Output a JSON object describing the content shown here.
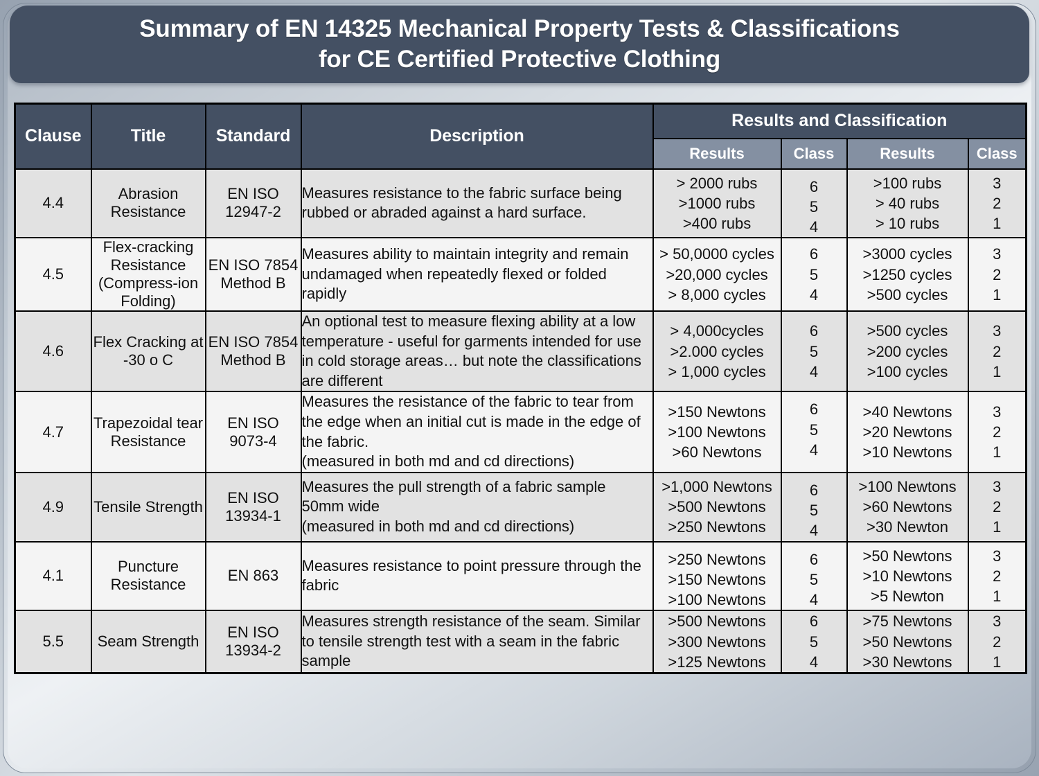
{
  "title": {
    "line1": "Summary of EN 14325 Mechanical Property Tests & Classifications",
    "line2": "for CE Certified Protective Clothing"
  },
  "colors": {
    "header_dark": "#445063",
    "header_light": "#8490a2",
    "row_shade": "#e2e2e2",
    "row_plain": "#f4f4f4",
    "border": "#000000",
    "title_text": "#ffffff"
  },
  "table": {
    "headers": {
      "clause": "Clause",
      "title": "Title",
      "standard": "Standard",
      "description": "Description",
      "group": "Results and Classification",
      "results_a": "Results",
      "class_a": "Class",
      "results_b": "Results",
      "class_b": "Class"
    },
    "rows": [
      {
        "clause": "4.4",
        "title": "Abrasion Resistance",
        "standard": "EN ISO 12947-2",
        "description": "Measures resistance to the fabric surface being rubbed or abraded against a hard surface.",
        "results_a": [
          "> 2000 rubs",
          ">1000 rubs",
          ">400 rubs"
        ],
        "class_a": [
          "6",
          "5",
          "4"
        ],
        "results_b": [
          ">100 rubs",
          "> 40 rubs",
          "> 10 rubs"
        ],
        "class_b": [
          "3",
          "2",
          "1"
        ],
        "shade": "shade",
        "class_a_align": "top",
        "class_b_align": "middle",
        "results_a_align": "middle",
        "results_b_align": "middle"
      },
      {
        "clause": "4.5",
        "title": "Flex-cracking Resistance (Compress-ion Folding)",
        "standard": "EN ISO 7854 Method B",
        "description": "Measures ability to maintain integrity and remain undamaged when repeatedly flexed or folded rapidly",
        "results_a": [
          "> 50,0000 cycles",
          ">20,000 cycles",
          "> 8,000 cycles"
        ],
        "class_a": [
          "6",
          "5",
          "4"
        ],
        "results_b": [
          ">3000 cycles",
          ">1250 cycles",
          ">500 cycles"
        ],
        "class_b": [
          "3",
          "2",
          "1"
        ],
        "shade": "plain",
        "class_a_align": "middle",
        "class_b_align": "middle",
        "results_a_align": "middle",
        "results_b_align": "middle"
      },
      {
        "clause": "4.6",
        "title": "Flex Cracking at -30 o C",
        "standard": "EN ISO 7854 Method B",
        "description": "An optional test to measure flexing ability at a low temperature - useful for garments intended for use in cold storage areas… but note the classifications are different",
        "results_a": [
          "> 4,000cycles",
          ">2.000 cycles",
          "> 1,000 cycles"
        ],
        "class_a": [
          "6",
          "5",
          "4"
        ],
        "results_b": [
          ">500 cycles",
          ">200 cycles",
          ">100 cycles"
        ],
        "class_b": [
          "3",
          "2",
          "1"
        ],
        "shade": "shade",
        "class_a_align": "middle",
        "class_b_align": "middle",
        "results_a_align": "middle",
        "results_b_align": "middle"
      },
      {
        "clause": "4.7",
        "title": "Trapezoidal tear Resistance",
        "standard": "EN ISO 9073-4",
        "description": "Measures the resistance of the fabric to tear from the edge when an initial cut is made in the edge of the fabric.\n(measured in both md and cd directions)",
        "results_a": [
          ">150 Newtons",
          ">100 Newtons",
          ">60 Newtons"
        ],
        "class_a": [
          "6",
          "5",
          "4"
        ],
        "results_b": [
          ">40 Newtons",
          ">20 Newtons",
          ">10 Newtons"
        ],
        "class_b": [
          "3",
          "2",
          "1"
        ],
        "shade": "plain",
        "class_a_align": "top",
        "class_b_align": "middle",
        "results_a_align": "middle",
        "results_b_align": "middle"
      },
      {
        "clause": "4.9",
        "title": "Tensile Strength",
        "standard": "EN ISO 13934-1",
        "description": "Measures the pull strength of a fabric sample 50mm wide\n(measured in both md and cd directions)",
        "results_a": [
          ">1,000 Newtons",
          ">500 Newtons",
          ">250 Newtons"
        ],
        "class_a": [
          "6",
          "5",
          "4"
        ],
        "results_b": [
          ">100 Newtons",
          ">60 Newtons",
          ">30 Newton"
        ],
        "class_b": [
          "3",
          "2",
          "1"
        ],
        "shade": "shade",
        "class_a_align": "top",
        "class_b_align": "middle",
        "results_a_align": "middle",
        "results_b_align": "middle"
      },
      {
        "clause": "4.1",
        "title": "Puncture Resistance",
        "standard": "EN 863",
        "description": "Measures resistance to point pressure through the fabric",
        "results_a": [
          ">250 Newtons",
          ">150 Newtons",
          ">100 Newtons"
        ],
        "class_a": [
          "6",
          "5",
          "4"
        ],
        "results_b": [
          ">50 Newtons",
          ">10 Newtons",
          ">5 Newton"
        ],
        "class_b": [
          "3",
          "2",
          "1"
        ],
        "shade": "plain",
        "class_a_align": "top",
        "class_b_align": "middle",
        "results_a_align": "top",
        "results_b_align": "middle"
      },
      {
        "clause": "5.5",
        "title": "Seam Strength",
        "standard": "EN ISO 13934-2",
        "description": "Measures strength resistance of the seam. Similar to tensile strength test with a seam in the fabric sample",
        "results_a": [
          ">500 Newtons",
          ">300 Newtons",
          ">125 Newtons"
        ],
        "class_a": [
          "6",
          "5",
          "4"
        ],
        "results_b": [
          ">75 Newtons",
          ">50 Newtons",
          ">30 Newtons"
        ],
        "class_b": [
          "3",
          "2",
          "1"
        ],
        "shade": "shade",
        "class_a_align": "middle",
        "class_b_align": "middle",
        "results_a_align": "middle",
        "results_b_align": "middle"
      }
    ]
  }
}
